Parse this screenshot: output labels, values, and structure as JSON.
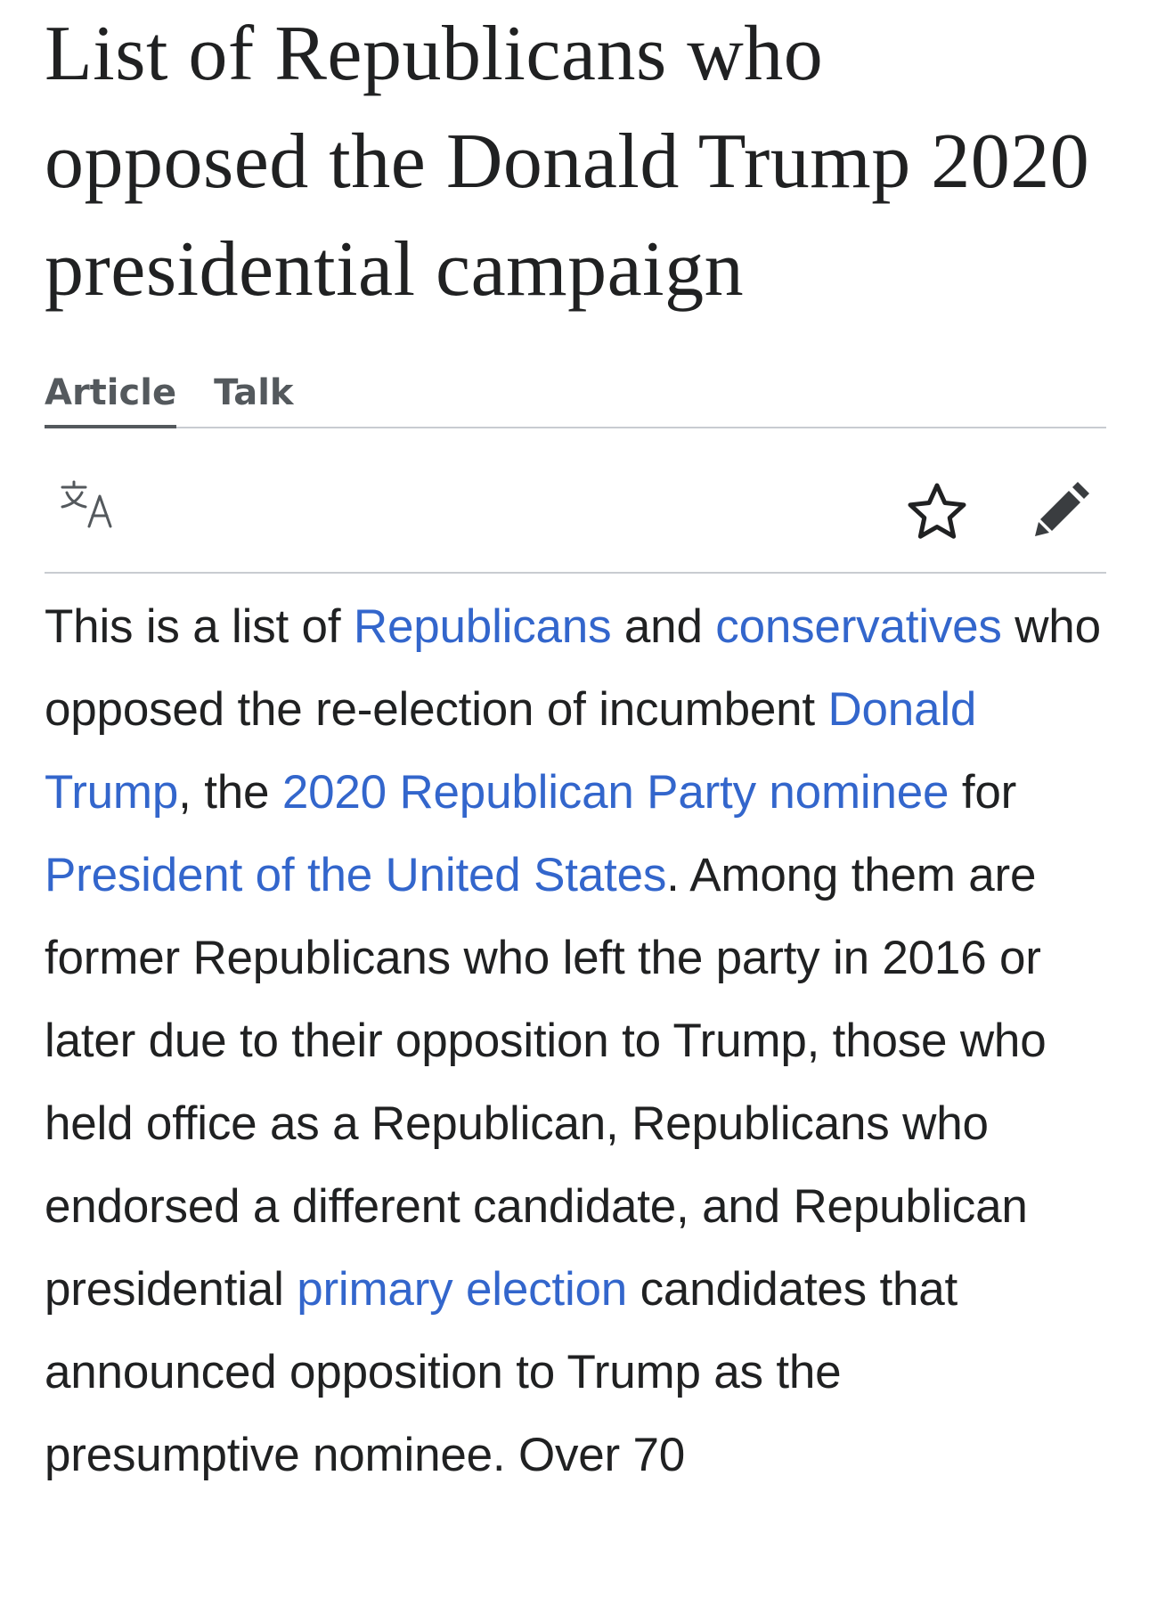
{
  "page": {
    "title": "List of Republicans who opposed the Donald Trump 2020 presidential campaign"
  },
  "tabs": [
    {
      "label": "Article",
      "selected": true
    },
    {
      "label": "Talk",
      "selected": false
    }
  ],
  "toolbar": {
    "language_icon": "translate-icon",
    "watch_icon": "star-icon",
    "edit_icon": "pencil-icon"
  },
  "intro": {
    "t1": "This is a list of ",
    "l1": "Republicans",
    "t2": " and ",
    "l2": "conservatives",
    "t3": " who opposed the re-election of incumbent ",
    "l3": "Donald Trump",
    "t4": ", the ",
    "l4": "2020 Republican Party nominee",
    "t5": " for ",
    "l5": "President of the United States",
    "t6": ". Among them are former Republicans who left the party in 2016 or later due to their opposition to Trump, those who held office as a Republican, Republicans who endorsed a different candidate, and Republican presidential ",
    "l6": "primary election",
    "t7": " candidates that announced opposition to Trump as the presumptive nominee. Over 70"
  },
  "colors": {
    "text": "#202122",
    "link": "#3366cc",
    "tab_text": "#54595d",
    "divider": "#c8ccd1"
  }
}
